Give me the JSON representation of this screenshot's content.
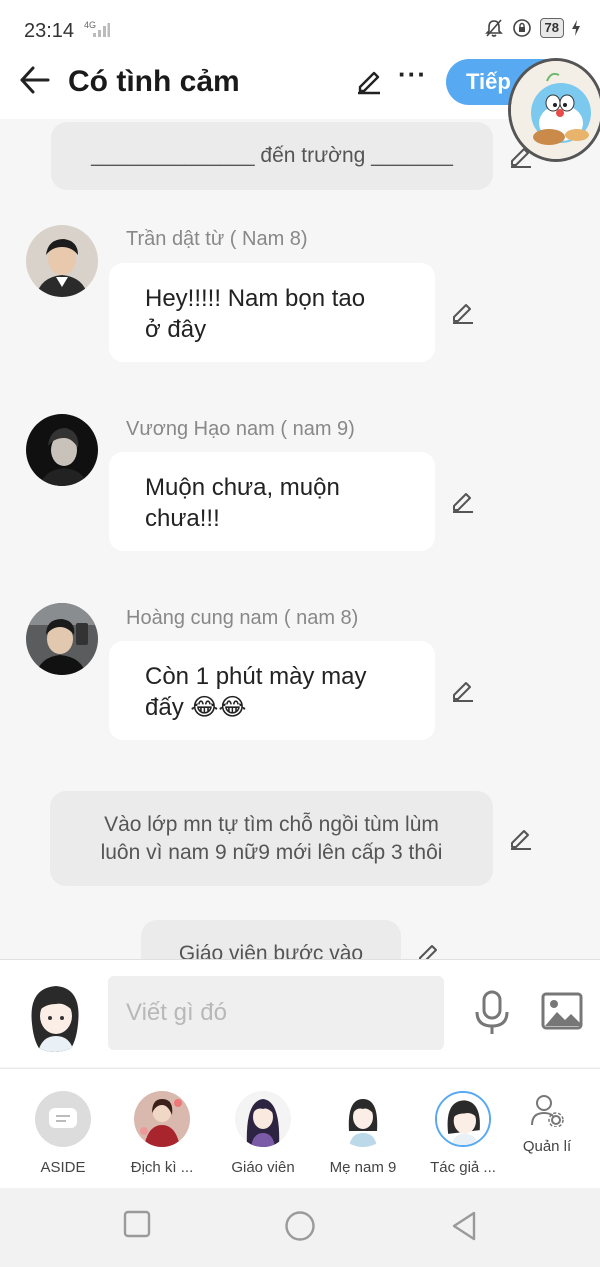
{
  "status": {
    "time": "23:14",
    "network": "4G",
    "battery": "78"
  },
  "header": {
    "title": "Có tình cảm",
    "next_label": "Tiếp"
  },
  "chat": {
    "narration_1": "______________ đến trường _______",
    "messages": [
      {
        "name": "Trần dật từ ( Nam 8)",
        "text_line1": "Hey!!!!!  Nam bọn tao",
        "text_line2": "ở đây"
      },
      {
        "name": "Vương Hạo nam ( nam 9)",
        "text_line1": "Muộn chưa, muộn",
        "text_line2": "chưa!!!"
      },
      {
        "name": "Hoàng cung nam ( nam 8)",
        "text_line1": "Còn 1 phút mày may",
        "text_line2": "đấy 😂😂"
      }
    ],
    "narration_2_line1": "Vào lớp mn tự tìm chỗ ngồi tùm lùm",
    "narration_2_line2": "luôn vì nam 9 nữ9 mới lên cấp 3 thôi",
    "narration_3": "Giáo viên bước vào"
  },
  "input": {
    "placeholder": "Viết gì đó"
  },
  "characters": [
    {
      "label": "ASIDE"
    },
    {
      "label": "Địch kì ..."
    },
    {
      "label": "Giáo viên"
    },
    {
      "label": "Mẹ nam 9"
    },
    {
      "label": "Tác giả ..."
    }
  ],
  "manage_label": "Quản lí",
  "colors": {
    "accent": "#57a9f2",
    "background": "#f6f6f6"
  }
}
